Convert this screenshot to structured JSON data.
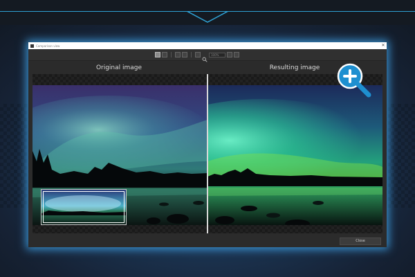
{
  "window": {
    "title": "Comparison view",
    "close_label": "Close"
  },
  "labels": {
    "original": "Original image",
    "result": "Resulting image"
  },
  "toolbar": {
    "zoom_value": "100%"
  },
  "icons": {
    "zoom_badge": "zoom-in-icon",
    "toolbar_zoom": "magnifier-icon"
  },
  "colors": {
    "accent": "#2fa3d6",
    "badge_blue": "#1e8fd0",
    "window_bg": "#2b2b2b"
  }
}
